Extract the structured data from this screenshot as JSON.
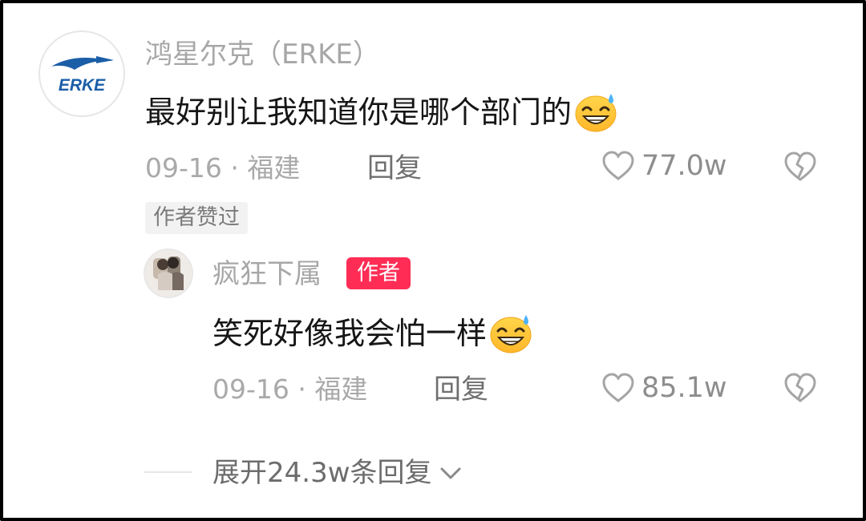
{
  "comment": {
    "username": "鸿星尔克（ERKE）",
    "avatar_text": "ERKE",
    "content": "最好别让我知道你是哪个部门的",
    "emoji": "grinning-sweat-emoji",
    "meta": "09-16 · 福建",
    "reply_label": "回复",
    "likes": "77.0w",
    "author_liked": "作者赞过"
  },
  "reply": {
    "username": "疯狂下属",
    "author_badge": "作者",
    "content": "笑死好像我会怕一样",
    "emoji": "grinning-sweat-emoji",
    "meta": "09-16 · 福建",
    "reply_label": "回复",
    "likes": "85.1w"
  },
  "expand": {
    "label": "展开24.3w条回复"
  },
  "colors": {
    "brand_blue": "#1b5ea8",
    "badge_red": "#ff2d55",
    "muted_text": "#a7a7a7"
  }
}
